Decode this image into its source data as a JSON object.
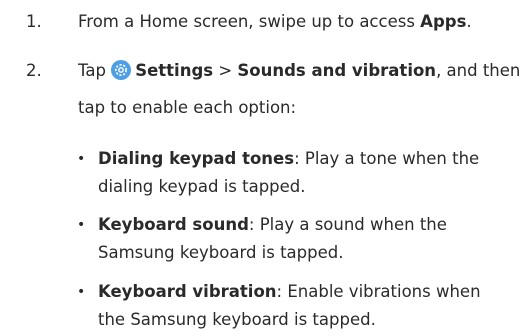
{
  "steps": [
    {
      "number": "1.",
      "text_before": "From a Home screen, swipe up to access ",
      "bold": "Apps",
      "text_after": "."
    },
    {
      "number": "2.",
      "text_tap": "Tap",
      "settings_label": "Settings",
      "separator": ">",
      "menu_label": "Sounds and vibration",
      "line1_after": ", and then",
      "line2": "tap to enable each option:"
    }
  ],
  "options": [
    {
      "title": "Dialing keypad tones",
      "line1_rest": ": Play a tone when the",
      "line2": "dialing keypad is tapped."
    },
    {
      "title": "Keyboard sound",
      "line1_rest": ": Play a sound when the",
      "line2": "Samsung keyboard is tapped."
    },
    {
      "title": "Keyboard vibration",
      "line1_rest": ": Enable vibrations when",
      "line2": "the Samsung keyboard is tapped."
    }
  ],
  "bullet_char": "•",
  "icons": {
    "settings": "settings-gear-icon",
    "settings_color": "#4e9fe5"
  }
}
